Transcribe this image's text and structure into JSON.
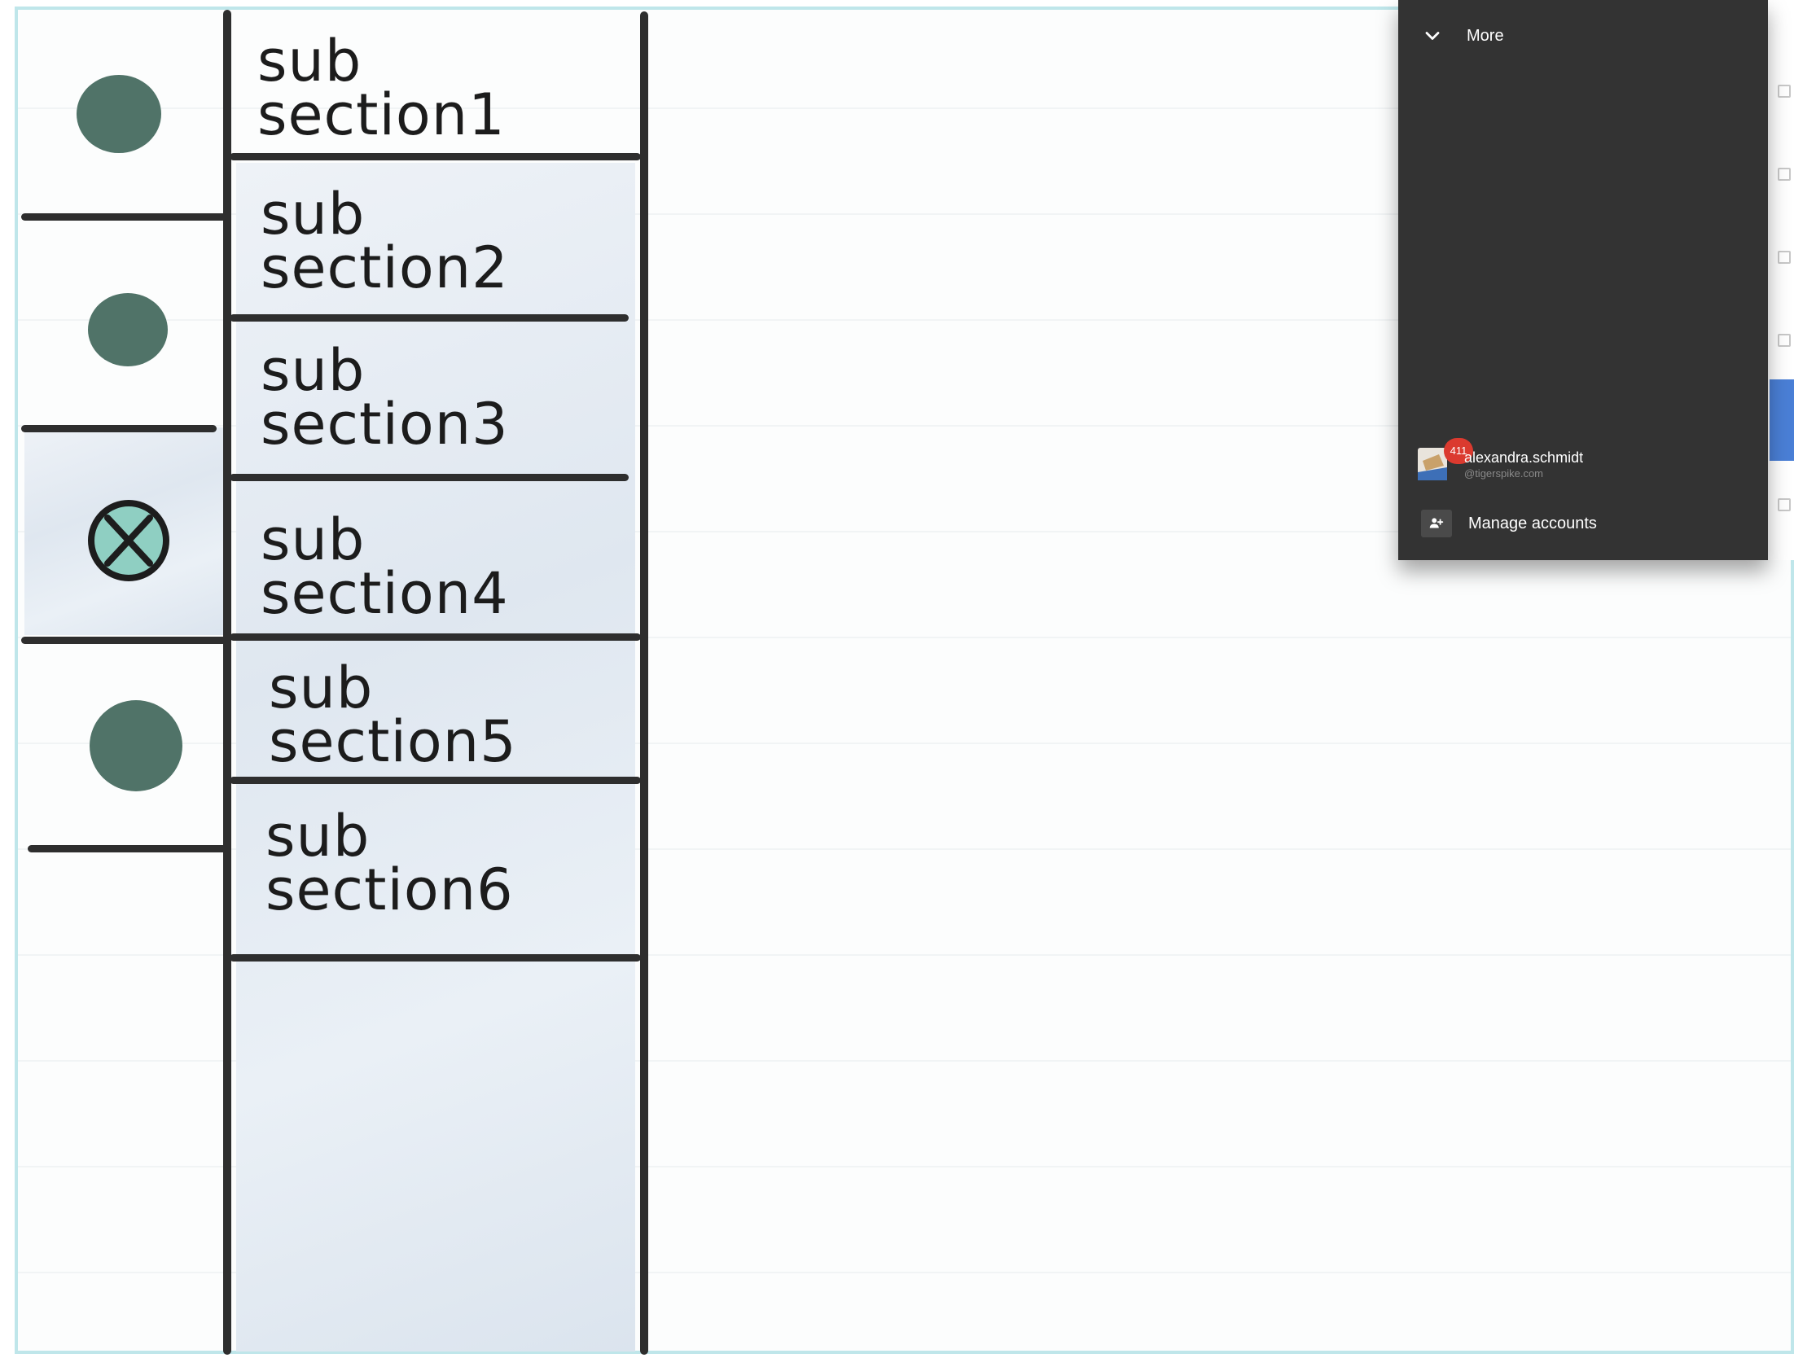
{
  "sketch": {
    "subsections": [
      {
        "line1": "sub",
        "line2": "section1",
        "marker": "filled-dot"
      },
      {
        "line1": "sub",
        "line2": "section2",
        "marker": "filled-dot"
      },
      {
        "line1": "sub",
        "line2": "section3",
        "marker": "none"
      },
      {
        "line1": "sub",
        "line2": "section4",
        "marker": "crossed-circle",
        "selected": true
      },
      {
        "line1": "sub",
        "line2": "section5",
        "marker": "filled-dot"
      },
      {
        "line1": "sub",
        "line2": "section6",
        "marker": "none"
      }
    ]
  },
  "account_menu": {
    "more_label": "More",
    "account_name": "alexandra.schmidt",
    "account_email": "@tigerspike.com",
    "unread_badge": "411",
    "manage_label": "Manage accounts"
  },
  "colors": {
    "panel_bg": "#333333",
    "badge": "#db3a2f",
    "selected_row": "#4a7fd6",
    "dot": "#476b60",
    "paper_border": "#bfe6ea"
  }
}
